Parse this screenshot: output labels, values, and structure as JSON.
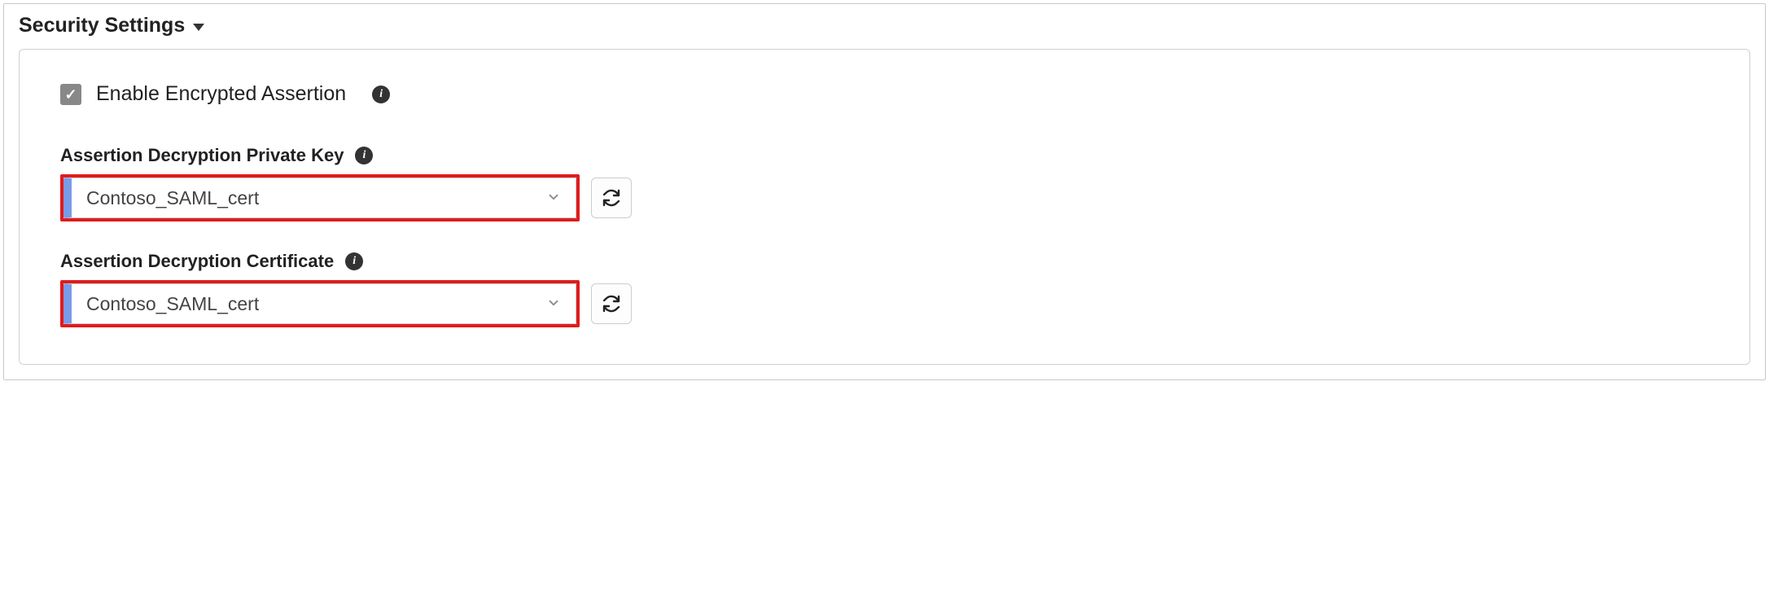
{
  "section": {
    "title": "Security Settings"
  },
  "checkbox": {
    "label": "Enable Encrypted Assertion",
    "checked": true
  },
  "fields": {
    "privateKey": {
      "label": "Assertion Decryption Private Key",
      "value": "Contoso_SAML_cert"
    },
    "certificate": {
      "label": "Assertion Decryption Certificate",
      "value": "Contoso_SAML_cert"
    }
  }
}
